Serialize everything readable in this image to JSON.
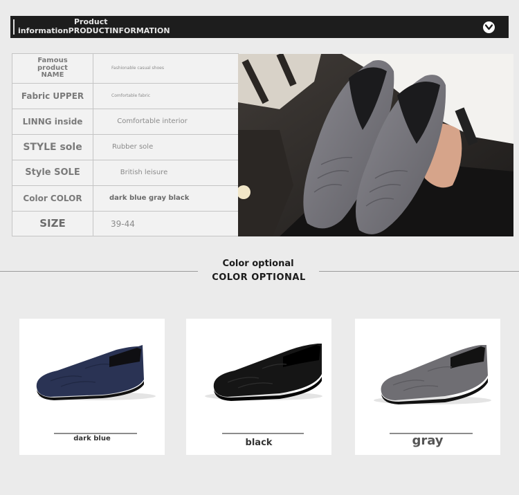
{
  "header": {
    "line1": "Product",
    "line2": "informationPRODUCTINFORMATION",
    "icon": "chevron-down-circle-icon"
  },
  "spec_table": [
    {
      "label": "Famous product NAME",
      "value": "Fashionable casual shoes"
    },
    {
      "label": "Fabric UPPER",
      "value": "Comfortable fabric"
    },
    {
      "label": "LINNG inside",
      "value": "Comfortable interior"
    },
    {
      "label": "STYLE sole",
      "value": "Rubber sole"
    },
    {
      "label": "Style SOLE",
      "value": "British leisure"
    },
    {
      "label": "Color COLOR",
      "value": "dark blue gray black"
    },
    {
      "label": "SIZE",
      "value": "39-44"
    }
  ],
  "section": {
    "title": "Color optional",
    "title_upper": "COLOR OPTIONAL"
  },
  "colors": [
    {
      "label": "dark blue",
      "swatch": "#2a3354"
    },
    {
      "label": "black",
      "swatch": "#141414"
    },
    {
      "label": "gray",
      "swatch": "#6f6e73"
    }
  ]
}
